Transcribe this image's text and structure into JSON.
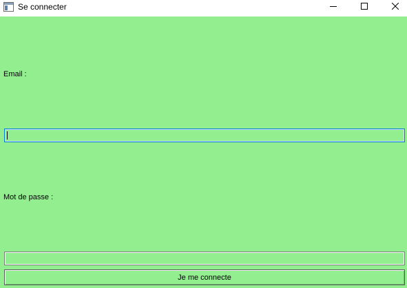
{
  "window": {
    "title": "Se connecter",
    "icons": {
      "app": "app-window-icon",
      "minimize": "minimize-icon",
      "maximize": "maximize-icon",
      "close": "close-icon"
    }
  },
  "form": {
    "email_label": "Email :",
    "email_value": "",
    "password_label": "Mot de passe :",
    "password_value": "",
    "submit_label": "Je me connecte"
  },
  "colors": {
    "background": "#93ee90",
    "focus_border": "#0078d7"
  }
}
